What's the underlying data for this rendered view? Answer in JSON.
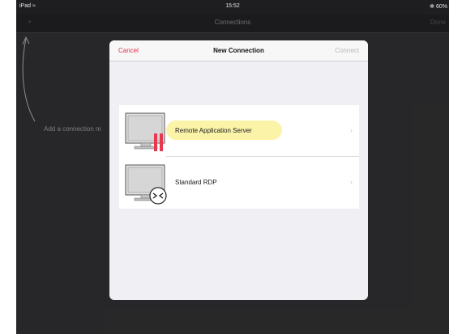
{
  "statusbar": {
    "device": "iPad",
    "time": "15:52",
    "battery": "60%"
  },
  "navbar": {
    "title": "Connections",
    "right_label": "Done"
  },
  "background": {
    "hint_text": "Add a connection m"
  },
  "modal": {
    "cancel_label": "Cancel",
    "title": "New Connection",
    "connect_label": "Connect",
    "options": [
      {
        "label": "Remote Application Server",
        "icon": "remote-app-server-icon"
      },
      {
        "label": "Standard RDP",
        "icon": "standard-rdp-icon"
      }
    ]
  },
  "colors": {
    "accent": "#e3324f",
    "highlight": "#fbf3a8",
    "background_dark": "#2b2b2d"
  }
}
